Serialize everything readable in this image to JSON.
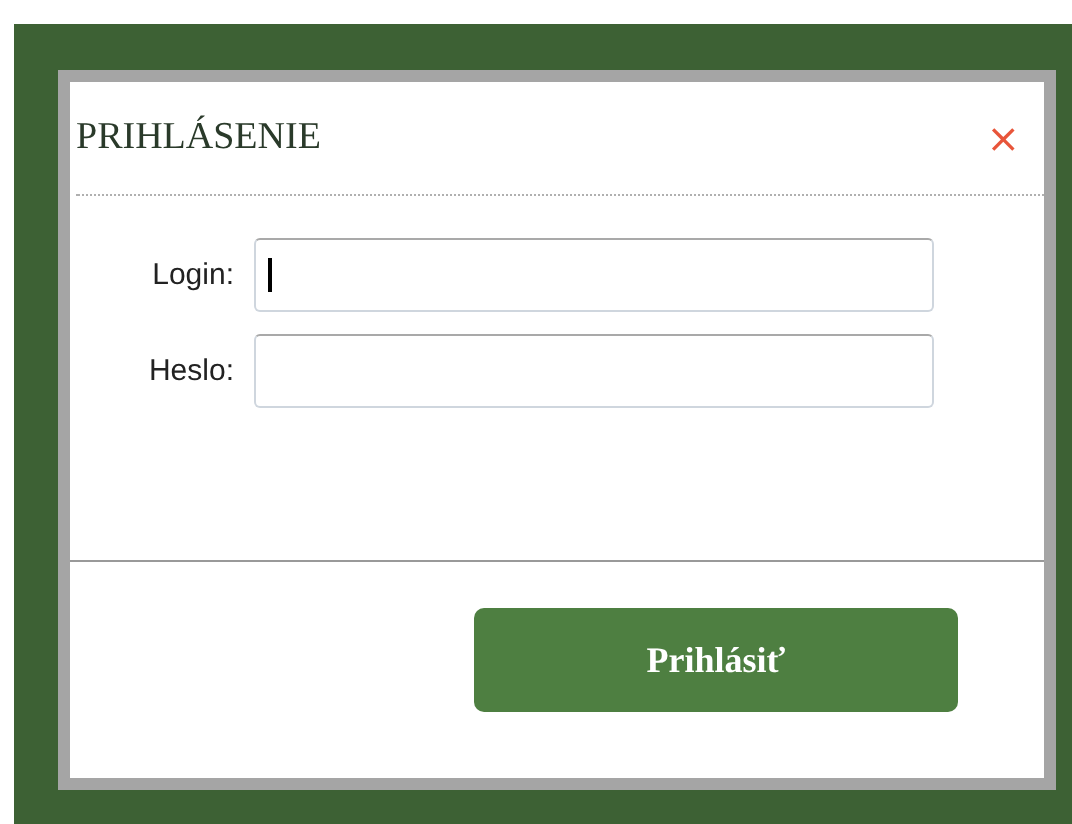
{
  "dialog": {
    "title": "PRIHLÁSENIE",
    "close": "×",
    "fields": [
      {
        "label": "Login:",
        "focused": true
      },
      {
        "label": "Heslo:",
        "focused": false
      }
    ],
    "submit": "Prihlásiť"
  }
}
